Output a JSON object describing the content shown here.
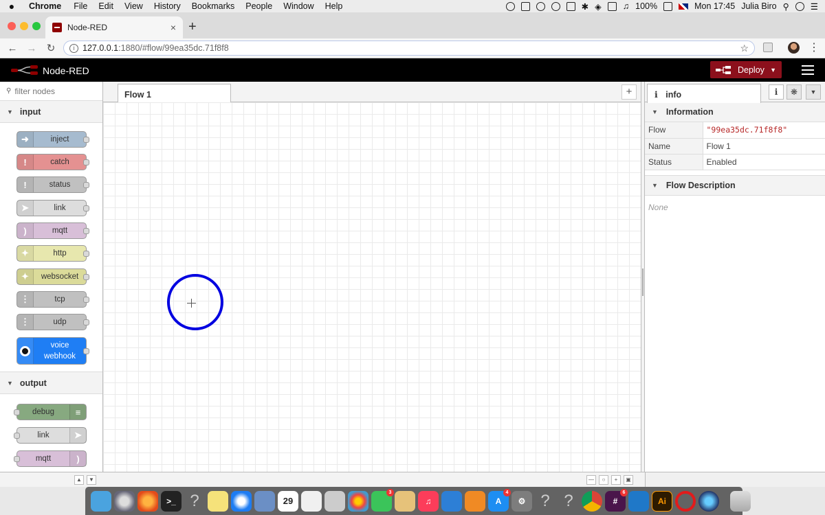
{
  "menubar": {
    "app": "Chrome",
    "items": [
      "File",
      "Edit",
      "View",
      "History",
      "Bookmarks",
      "People",
      "Window",
      "Help"
    ],
    "battery": "100%",
    "clock": "Mon 17:45",
    "user": "Julia Biro"
  },
  "browser": {
    "tab_title": "Node-RED",
    "tab_close": "×",
    "new_tab": "+",
    "url_host": "127.0.0.1",
    "url_path": ":1880/#flow/99ea35dc.71f8f8"
  },
  "header": {
    "title": "Node-RED",
    "deploy_label": "Deploy"
  },
  "palette": {
    "filter_placeholder": "filter nodes",
    "categories": [
      {
        "name": "input",
        "nodes": [
          {
            "label": "inject",
            "color": "#a6bbcf"
          },
          {
            "label": "catch",
            "color": "#e49191"
          },
          {
            "label": "status",
            "color": "#c0c0c0"
          },
          {
            "label": "link",
            "color": "#dddddd"
          },
          {
            "label": "mqtt",
            "color": "#d8bfd8"
          },
          {
            "label": "http",
            "color": "#e7e7ae"
          },
          {
            "label": "websocket",
            "color": "#dbdb9a"
          },
          {
            "label": "tcp",
            "color": "#c0c0c0"
          },
          {
            "label": "udp",
            "color": "#c0c0c0"
          },
          {
            "label": "voice webhook",
            "color": "#1f7ef4"
          }
        ]
      },
      {
        "name": "output",
        "nodes": [
          {
            "label": "debug",
            "color": "#87a980"
          },
          {
            "label": "link",
            "color": "#dddddd"
          },
          {
            "label": "mqtt",
            "color": "#d8bfd8"
          }
        ]
      }
    ]
  },
  "workspace": {
    "tabs": [
      {
        "label": "Flow 1"
      }
    ],
    "add_tab": "+"
  },
  "sidebar": {
    "tab_label": "info",
    "information_heading": "Information",
    "rows": [
      {
        "key": "Flow",
        "value": "\"99ea35dc.71f8f8\""
      },
      {
        "key": "Name",
        "value": "Flow 1"
      },
      {
        "key": "Status",
        "value": "Enabled"
      }
    ],
    "description_heading": "Flow Description",
    "description": "None"
  },
  "dock": {
    "calendar_day": "29",
    "messages_badge": "3",
    "slack_badge": "6",
    "appstore_badge": "4",
    "illustrator_label": "Ai"
  },
  "colors": {
    "deploy": "#8c101c",
    "header": "#000000",
    "cursor_ring": "#0000e0"
  }
}
